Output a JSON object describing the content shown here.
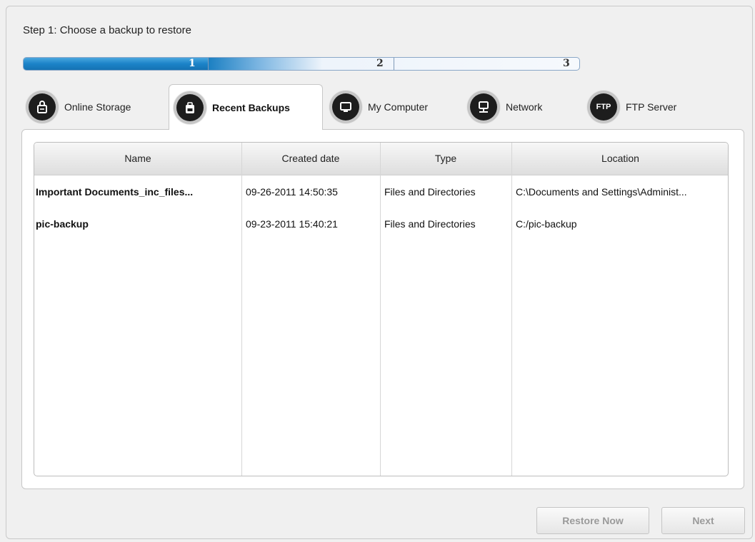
{
  "step_title": "Step 1: Choose a backup to restore",
  "progress": {
    "steps": [
      "1",
      "2",
      "3"
    ],
    "current_step": 1,
    "colors": {
      "fill": "#1b83c8",
      "track": "#e9f1fa"
    }
  },
  "tabs": [
    {
      "label": "Online Storage",
      "icon": "lock-icon"
    },
    {
      "label": "Recent Backups",
      "icon": "backpack-icon",
      "active": true
    },
    {
      "label": "My Computer",
      "icon": "monitor-icon"
    },
    {
      "label": "Network",
      "icon": "network-monitor-icon"
    },
    {
      "label": "FTP Server",
      "icon": "ftp-icon",
      "icon_text": "FTP"
    }
  ],
  "table": {
    "columns": [
      "Name",
      "Created date",
      "Type",
      "Location"
    ],
    "rows": [
      [
        "Important Documents_inc_files...",
        "09-26-2011 14:50:35",
        "Files and Directories",
        "C:\\Documents and Settings\\Administ..."
      ],
      [
        "pic-backup",
        "09-23-2011 15:40:21",
        "Files and Directories",
        "C:/pic-backup"
      ]
    ]
  },
  "buttons": {
    "restore_now": "Restore Now",
    "next": "Next"
  }
}
